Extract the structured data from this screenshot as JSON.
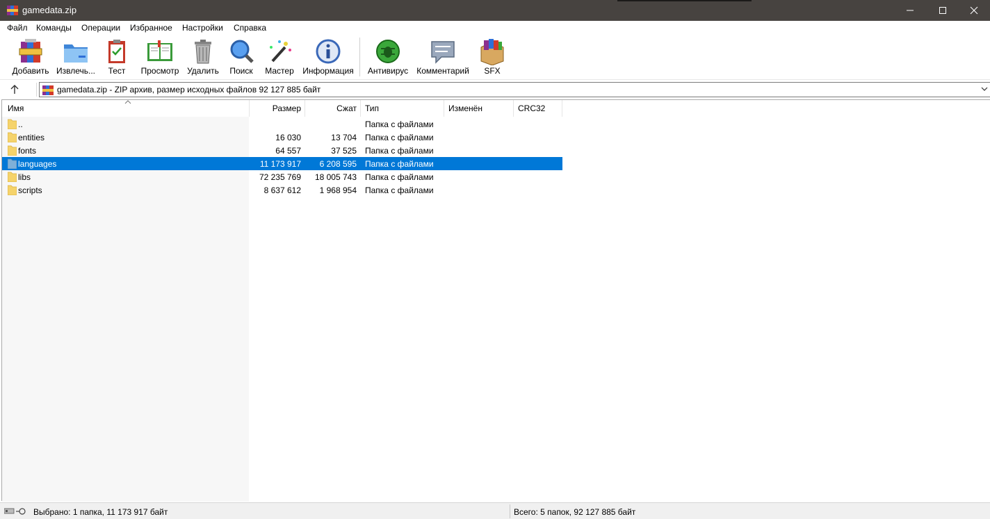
{
  "window": {
    "title": "gamedata.zip",
    "controls": [
      "minimize-icon",
      "maximize-icon",
      "close-icon"
    ]
  },
  "menu": [
    "Файл",
    "Команды",
    "Операции",
    "Избранное",
    "Настройки",
    "Справка"
  ],
  "toolbar": [
    {
      "label": "Добавить",
      "icon": "add-archive-icon"
    },
    {
      "label": "Извлечь...",
      "icon": "extract-folder-icon"
    },
    {
      "label": "Тест",
      "icon": "test-clipboard-icon"
    },
    {
      "label": "Просмотр",
      "icon": "view-book-icon"
    },
    {
      "label": "Удалить",
      "icon": "trash-icon"
    },
    {
      "label": "Поиск",
      "icon": "search-magnifier-icon"
    },
    {
      "label": "Мастер",
      "icon": "wizard-wand-icon"
    },
    {
      "label": "Информация",
      "icon": "info-icon"
    },
    {
      "label": "Антивирус",
      "icon": "antivirus-bug-icon"
    },
    {
      "label": "Комментарий",
      "icon": "comment-icon"
    },
    {
      "label": "SFX",
      "icon": "sfx-box-icon"
    }
  ],
  "address": {
    "text": "gamedata.zip - ZIP архив, размер исходных файлов 92 127 885 байт"
  },
  "columns": [
    "Имя",
    "Размер",
    "Сжат",
    "Тип",
    "Изменён",
    "CRC32"
  ],
  "files": [
    {
      "name": "..",
      "size": "",
      "packed": "",
      "type": "Папка с файлами"
    },
    {
      "name": "entities",
      "size": "16 030",
      "packed": "13 704",
      "type": "Папка с файлами"
    },
    {
      "name": "fonts",
      "size": "64 557",
      "packed": "37 525",
      "type": "Папка с файлами"
    },
    {
      "name": "languages",
      "size": "11 173 917",
      "packed": "6 208 595",
      "type": "Папка с файлами",
      "selected": true
    },
    {
      "name": "libs",
      "size": "72 235 769",
      "packed": "18 005 743",
      "type": "Папка с файлами"
    },
    {
      "name": "scripts",
      "size": "8 637 612",
      "packed": "1 968 954",
      "type": "Папка с файлами"
    }
  ],
  "status": {
    "left": "Выбрано: 1 папка, 11 173 917 байт",
    "right": "Всего: 5 папок, 92 127 885 байт"
  },
  "colors": {
    "titlebar": "#474340",
    "selection": "#0078d7",
    "folder": "#f5d36b"
  }
}
